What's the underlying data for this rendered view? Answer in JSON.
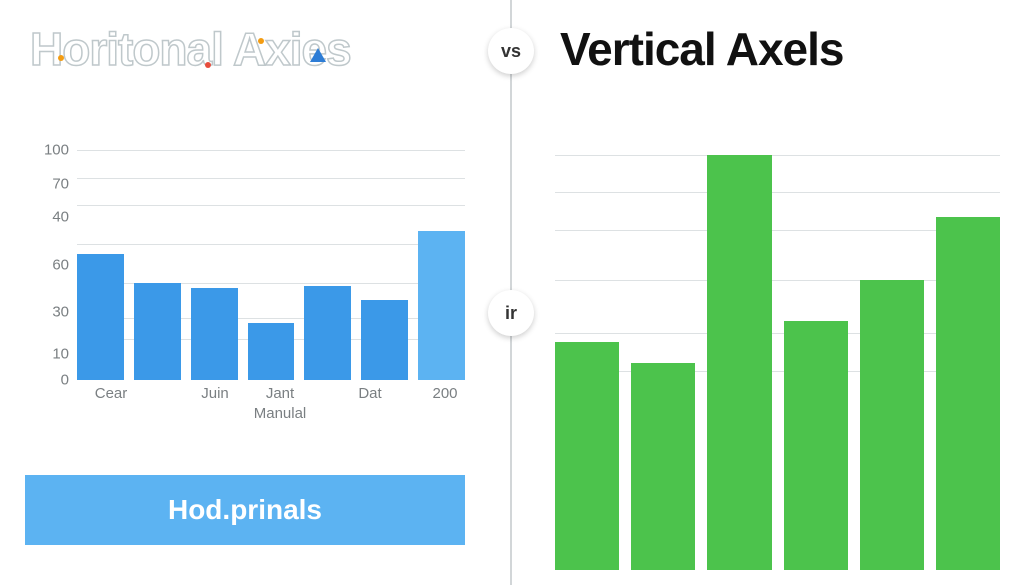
{
  "header": {
    "left_title": "Horitonal Axies",
    "right_title": "Vertical Axels",
    "vs_badge": "vs",
    "ir_badge": "ir"
  },
  "button": {
    "label": "Hod.prinals"
  },
  "left_chart": {
    "y_ticks": [
      "100",
      "70",
      "40",
      "60",
      "30",
      "10",
      "0"
    ],
    "x_categories": [
      "Cear",
      "Juin",
      "Jant",
      "Dat",
      "200"
    ],
    "x_sublabel": "Manulal"
  },
  "chart_data": [
    {
      "type": "bar",
      "name": "left_chart",
      "title": "",
      "categories": [
        "Cear",
        "",
        "Juin",
        "Jant",
        "",
        "Dat",
        "200"
      ],
      "values": [
        55,
        42,
        40,
        25,
        41,
        35,
        65
      ],
      "y_ticks_as_shown": [
        0,
        10,
        30,
        60,
        40,
        70,
        100
      ],
      "ylim": [
        0,
        100
      ],
      "xlabel": "Manulal",
      "ylabel": "",
      "colors": {
        "default": "#3b99e8",
        "last": "#5cb3f2"
      }
    },
    {
      "type": "bar",
      "name": "right_chart",
      "title": "",
      "categories": [
        "",
        "",
        "",
        "",
        "",
        ""
      ],
      "values": [
        55,
        50,
        100,
        60,
        70,
        85
      ],
      "ylim": [
        0,
        100
      ],
      "xlabel": "",
      "ylabel": "",
      "color": "#4cc34c"
    }
  ]
}
